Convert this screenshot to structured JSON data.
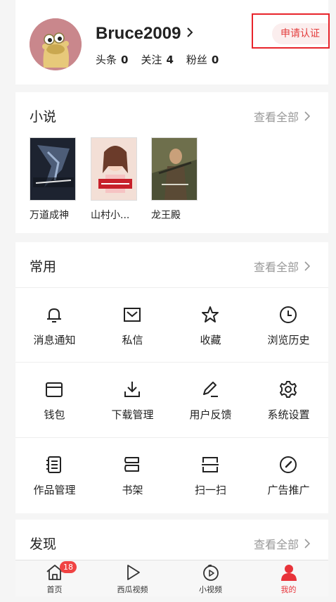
{
  "profile": {
    "username": "Bruce2009",
    "stats": [
      {
        "label": "头条",
        "value": "0"
      },
      {
        "label": "关注",
        "value": "4"
      },
      {
        "label": "粉丝",
        "value": "0"
      }
    ],
    "verify_label": "申请认证"
  },
  "novels": {
    "title": "小说",
    "see_all": "查看全部",
    "books": [
      {
        "title": "万道成神"
      },
      {
        "title": "山村小..."
      },
      {
        "title": "龙王殿"
      }
    ]
  },
  "common": {
    "title": "常用",
    "see_all": "查看全部",
    "tools": [
      {
        "label": "消息通知",
        "icon": "bell-icon"
      },
      {
        "label": "私信",
        "icon": "mail-icon"
      },
      {
        "label": "收藏",
        "icon": "star-icon"
      },
      {
        "label": "浏览历史",
        "icon": "clock-icon"
      },
      {
        "label": "钱包",
        "icon": "wallet-icon"
      },
      {
        "label": "下载管理",
        "icon": "download-icon"
      },
      {
        "label": "用户反馈",
        "icon": "pen-icon"
      },
      {
        "label": "系统设置",
        "icon": "gear-icon"
      },
      {
        "label": "作品管理",
        "icon": "notebook-icon"
      },
      {
        "label": "书架",
        "icon": "bookshelf-icon"
      },
      {
        "label": "扫一扫",
        "icon": "scan-icon"
      },
      {
        "label": "广告推广",
        "icon": "gauge-icon"
      }
    ]
  },
  "discover": {
    "title": "发现",
    "see_all": "查看全部"
  },
  "tabbar": {
    "tabs": [
      {
        "label": "首页",
        "icon": "home-icon",
        "badge": "18"
      },
      {
        "label": "西瓜视频",
        "icon": "play-icon"
      },
      {
        "label": "小视频",
        "icon": "short-video-icon"
      },
      {
        "label": "我的",
        "icon": "person-icon",
        "active": true
      }
    ]
  },
  "colors": {
    "accent": "#e8333a",
    "highlight_box": "#e8242b",
    "muted_text": "#999999",
    "background": "#f5f5f5"
  }
}
